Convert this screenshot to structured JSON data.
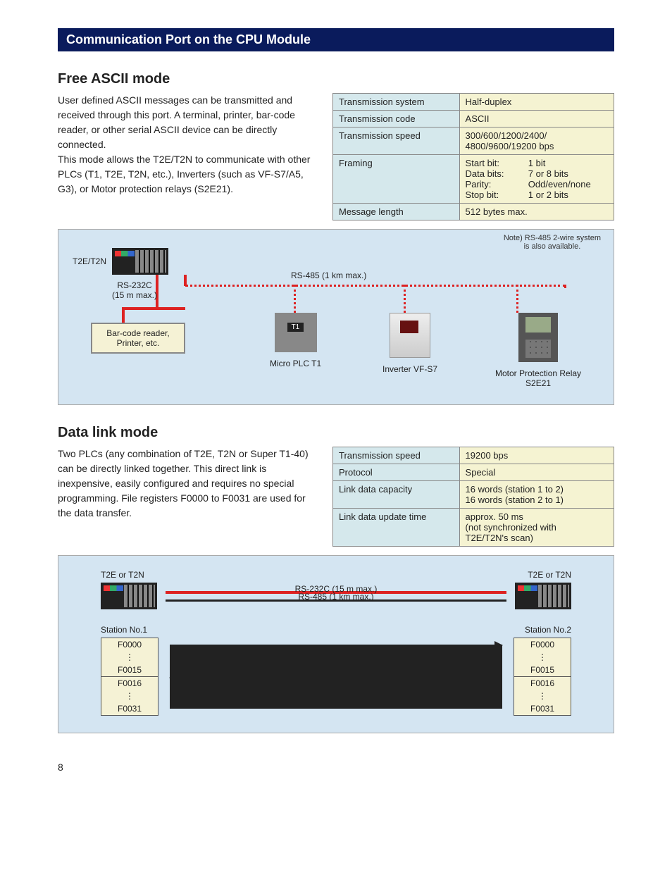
{
  "title_bar": "Communication Port on the CPU Module",
  "section1": {
    "heading": "Free ASCII mode",
    "paragraph": "User defined ASCII messages can be transmitted and received through this port. A terminal, printer, bar-code reader, or other serial ASCII device can be directly connected.\nThis mode allows the T2E/T2N to communicate with other PLCs (T1, T2E, T2N, etc.), Inverters (such as VF-S7/A5, G3), or Motor protection relays (S2E21)."
  },
  "table1": [
    {
      "k": "Transmission system",
      "v": "Half-duplex"
    },
    {
      "k": "Transmission code",
      "v": "ASCII"
    },
    {
      "k": "Transmission speed",
      "v": "300/600/1200/2400/\n4800/9600/19200 bps"
    },
    {
      "k": "Framing",
      "framing": [
        [
          "Start bit:",
          "1 bit"
        ],
        [
          "Data bits:",
          "7 or 8 bits"
        ],
        [
          "Parity:",
          "Odd/even/none"
        ],
        [
          "Stop bit:",
          "1 or 2 bits"
        ]
      ]
    },
    {
      "k": "Message length",
      "v": "512 bytes max."
    }
  ],
  "diagram1": {
    "note": "Note) RS-485 2-wire system\nis also available.",
    "plc_label": "T2E/T2N",
    "rs232_lbl": "RS-232C\n(15 m max.)",
    "rs485_lbl": "RS-485 (1 km max.)",
    "dev_barcode": "Bar-code reader,\nPrinter, etc.",
    "dev_t1": "Micro PLC T1",
    "dev_t1_inner": "T1",
    "dev_inverter": "Inverter VF-S7",
    "dev_relay": "Motor Protection Relay\nS2E21"
  },
  "section2": {
    "heading": "Data link mode",
    "paragraph": "Two PLCs (any combination of T2E, T2N or Super T1-40) can be directly linked together. This direct link is inexpensive, easily configured and requires no special programming. File registers F0000 to F0031 are used for the data transfer."
  },
  "table2": [
    {
      "k": "Transmission speed",
      "v": "19200 bps"
    },
    {
      "k": "Protocol",
      "v": "Special"
    },
    {
      "k": "Link data capacity",
      "v": "16 words (station 1 to 2)\n16 words (station 2 to 1)"
    },
    {
      "k": "Link data update time",
      "v": "approx. 50 ms\n(not synchronized with\nT2E/T2N's scan)"
    }
  ],
  "diagram2": {
    "plc_left": "T2E or T2N",
    "plc_right": "T2E or T2N",
    "line1": "RS-232C (15 m max.)",
    "line2": "RS-485 (1 km max.)",
    "station1": "Station No.1",
    "station2": "Station No.2",
    "regs_top": [
      "F0000",
      "⋮",
      "F0015"
    ],
    "regs_bot": [
      "F0016",
      "⋮",
      "F0031"
    ]
  },
  "page_number": "8"
}
